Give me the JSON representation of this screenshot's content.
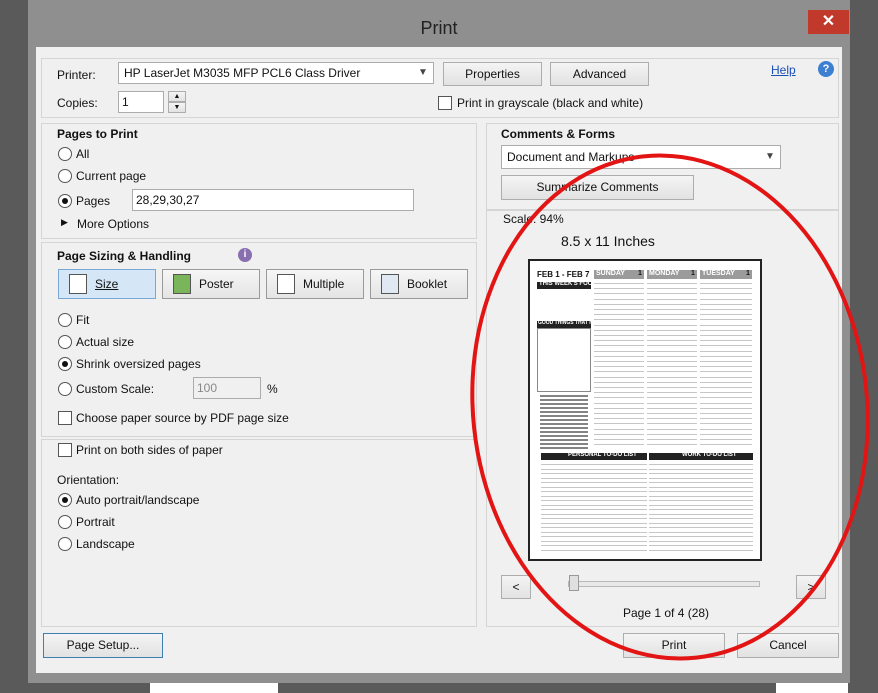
{
  "window": {
    "title": "Print",
    "close_glyph": "✕"
  },
  "printer": {
    "label": "Printer:",
    "value": "HP LaserJet M3035 MFP PCL6 Class Driver",
    "properties_button": "Properties",
    "advanced_button": "Advanced",
    "help_link": "Help",
    "copies_label": "Copies:",
    "copies_value": "1",
    "grayscale_label": "Print in grayscale (black and white)",
    "grayscale_checked": false
  },
  "pages_to_print": {
    "heading": "Pages to Print",
    "options": [
      {
        "label": "All",
        "selected": false
      },
      {
        "label": "Current page",
        "selected": false
      },
      {
        "label": "Pages",
        "selected": true
      }
    ],
    "pages_value": "28,29,30,27",
    "more_options": "More Options"
  },
  "sizing": {
    "heading": "Page Sizing & Handling",
    "modes": [
      {
        "label": "Size",
        "selected": true,
        "icon": "size-icon"
      },
      {
        "label": "Poster",
        "selected": false,
        "icon": "poster-icon"
      },
      {
        "label": "Multiple",
        "selected": false,
        "icon": "multiple-icon"
      },
      {
        "label": "Booklet",
        "selected": false,
        "icon": "booklet-icon"
      }
    ],
    "options": [
      {
        "label": "Fit",
        "selected": false
      },
      {
        "label": "Actual size",
        "selected": false
      },
      {
        "label": "Shrink oversized pages",
        "selected": true
      },
      {
        "label": "Custom Scale:",
        "selected": false
      }
    ],
    "custom_scale_value": "100",
    "custom_scale_unit": "%",
    "paper_source_label": "Choose paper source by PDF page size"
  },
  "duplex": {
    "label": "Print on both sides of paper"
  },
  "orientation": {
    "heading": "Orientation:",
    "options": [
      {
        "label": "Auto portrait/landscape",
        "selected": true
      },
      {
        "label": "Portrait",
        "selected": false
      },
      {
        "label": "Landscape",
        "selected": false
      }
    ]
  },
  "comments": {
    "heading": "Comments & Forms",
    "value": "Document and Markups",
    "summarize_button": "Summarize Comments"
  },
  "preview": {
    "scale_text": "Scale: 94%",
    "paper_size": "8.5 x 11 Inches",
    "page_info": "Page 1 of 4 (28)",
    "prev_glyph": "<",
    "next_glyph": ">",
    "slider_position": 0,
    "content": {
      "date_range": "FEB 1 - FEB 7",
      "days": [
        "SUNDAY",
        "MONDAY",
        "TUESDAY"
      ],
      "day_nums": [
        "1",
        "1",
        "1"
      ],
      "focus": "THIS WEEK'S FOCUS",
      "good_things": "GOOD THINGS THAT HAPPENED",
      "personal": "PERSONAL TO-DO LIST",
      "work": "WORK TO-DO LIST"
    }
  },
  "footer": {
    "page_setup_button": "Page Setup...",
    "print_button": "Print",
    "cancel_button": "Cancel"
  }
}
